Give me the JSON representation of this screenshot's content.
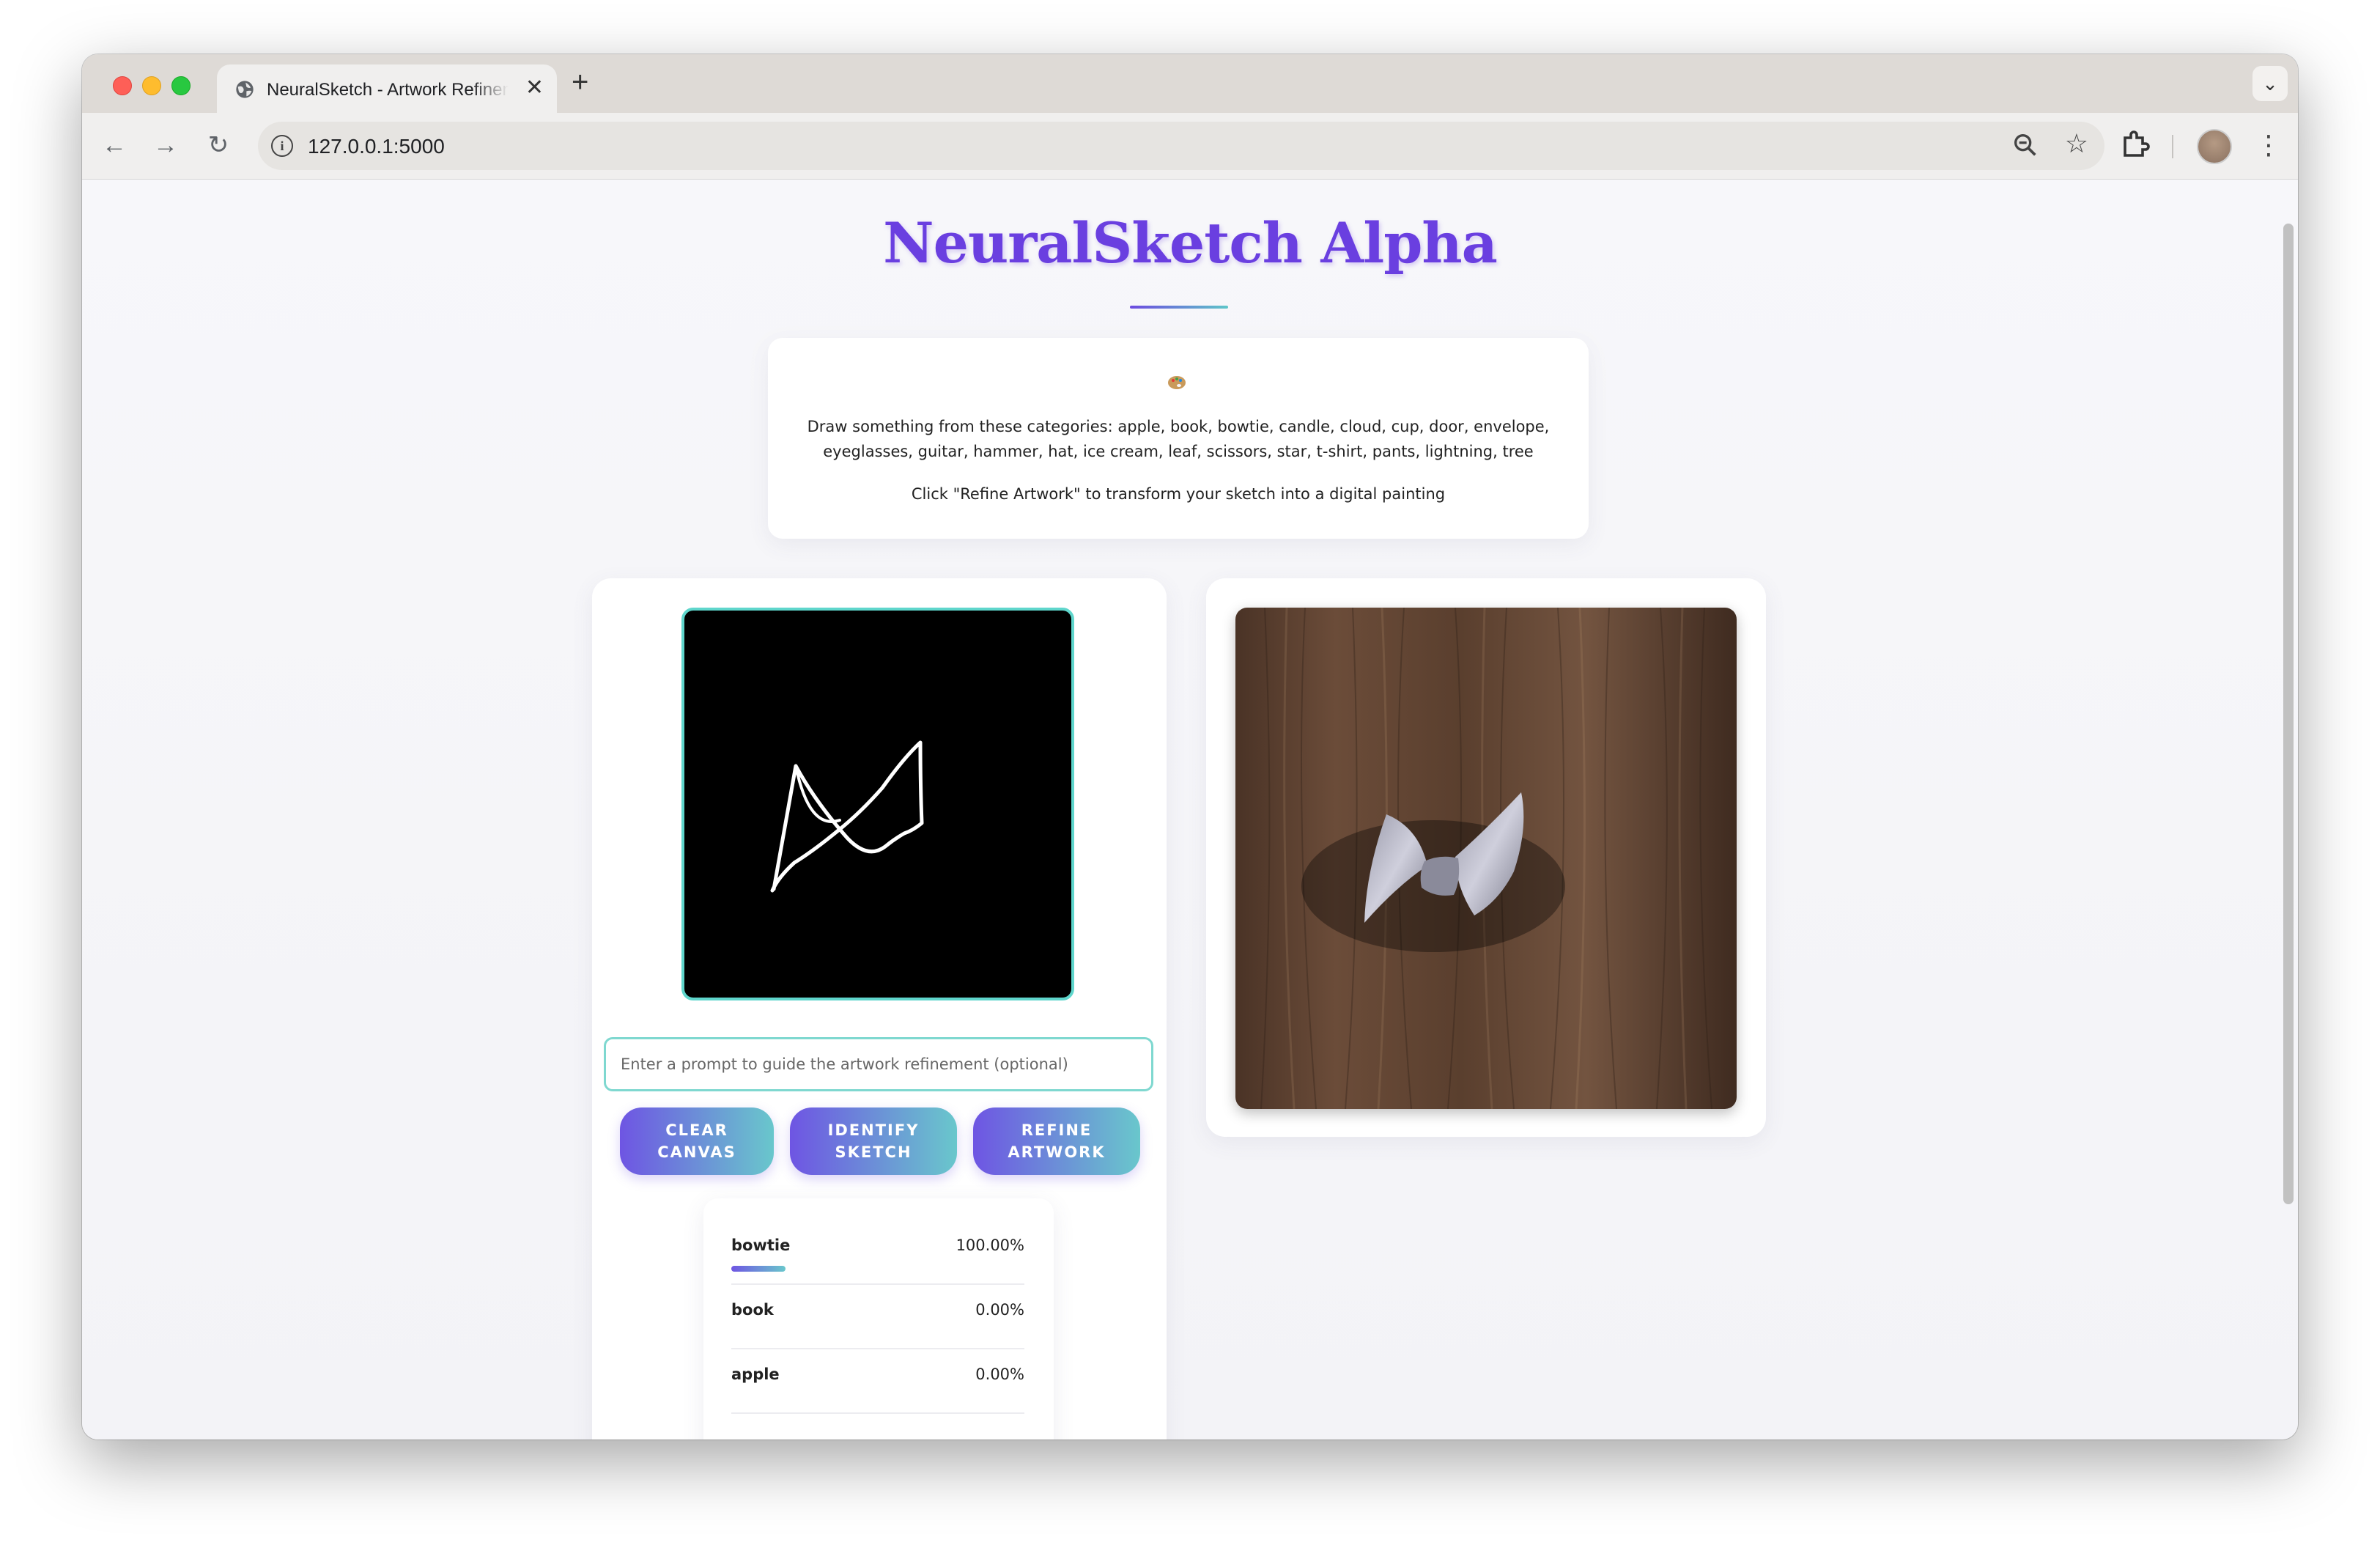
{
  "browser": {
    "tab_title": "NeuralSketch - Artwork Refinement",
    "tab_close": "✕",
    "new_tab": "+",
    "url": "127.0.0.1:5000",
    "icons": [
      "globe-icon",
      "back-icon",
      "forward-icon",
      "reload-icon",
      "info-icon",
      "zoom-icon",
      "star-icon",
      "extensions-icon",
      "profile-avatar",
      "menu-icon"
    ]
  },
  "app": {
    "title": "NeuralSketch Alpha",
    "accent_color": "#6a3fe0",
    "secondary_color": "#5ec6c9",
    "instructions": {
      "icon": "palette-icon",
      "categories_text": "Draw something from these categories: apple, book, bowtie, candle, cloud, cup, door, envelope, eyeglasses, guitar, hammer, hat, ice cream, leaf, scissors, star, t-shirt, pants, lightning, tree",
      "hint_text": "Click \"Refine Artwork\" to transform your sketch into a digital painting"
    },
    "prompt": {
      "value": "",
      "placeholder": "Enter a prompt to guide the artwork refinement (optional)"
    },
    "buttons": {
      "clear": "CLEAR CANVAS",
      "identify": "IDENTIFY SKETCH",
      "refine": "REFINE ARTWORK"
    },
    "predictions": [
      {
        "label": "bowtie",
        "percent": "100.00%",
        "fraction": 1.0
      },
      {
        "label": "book",
        "percent": "0.00%",
        "fraction": 0.0
      },
      {
        "label": "apple",
        "percent": "0.00%",
        "fraction": 0.0
      }
    ],
    "canvas": {
      "sketch_subject": "bowtie sketch"
    },
    "output": {
      "image_subject": "grey bowtie on dark wood"
    }
  }
}
